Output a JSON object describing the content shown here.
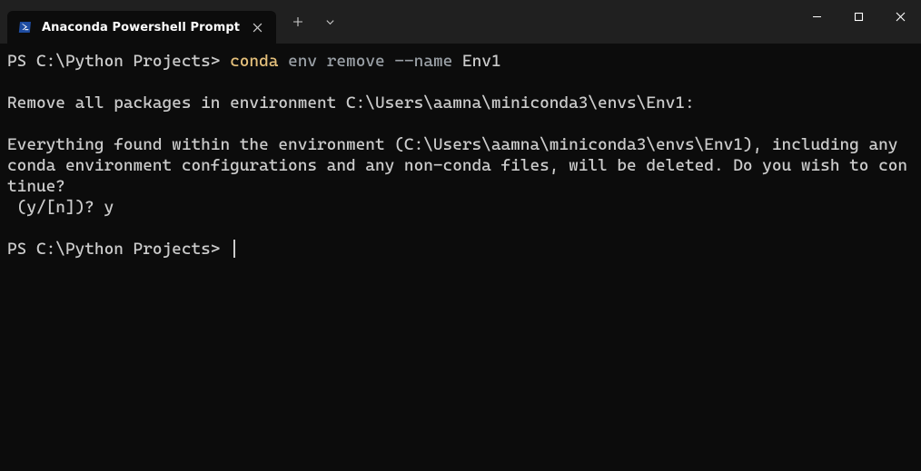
{
  "tab": {
    "title": "Anaconda Powershell Prompt"
  },
  "terminal": {
    "prompt1": "PS C:\\Python Projects> ",
    "cmd": {
      "conda": "conda",
      "env": "env",
      "remove": "remove",
      "flag": "--name",
      "arg": "Env1"
    },
    "blank": "",
    "line2": "Remove all packages in environment C:\\Users\\aamna\\miniconda3\\envs\\Env1:",
    "blank2": "",
    "line3": "Everything found within the environment (C:\\Users\\aamna\\miniconda3\\envs\\Env1), including any conda environment configurations and any non-conda files, will be deleted. Do you wish to continue?",
    "line4": " (y/[n])? y",
    "blank3": "",
    "prompt2": "PS C:\\Python Projects> "
  }
}
